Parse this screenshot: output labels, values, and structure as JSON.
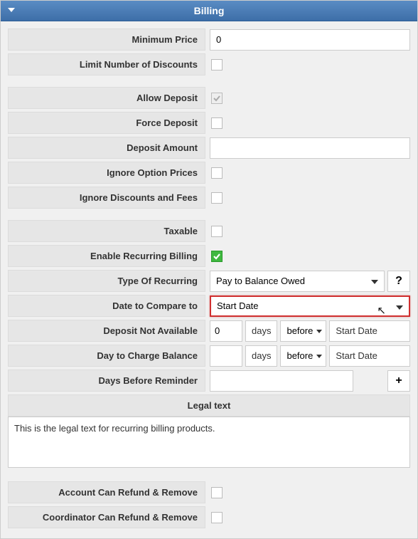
{
  "header": {
    "title": "Billing"
  },
  "fields": {
    "minimum_price": {
      "label": "Minimum Price",
      "value": "0"
    },
    "limit_discounts": {
      "label": "Limit Number of Discounts",
      "checked": false
    },
    "allow_deposit": {
      "label": "Allow Deposit",
      "checked": true,
      "disabled": true
    },
    "force_deposit": {
      "label": "Force Deposit",
      "checked": false
    },
    "deposit_amount": {
      "label": "Deposit Amount",
      "value": ""
    },
    "ignore_option_prices": {
      "label": "Ignore Option Prices",
      "checked": false
    },
    "ignore_discounts_fees": {
      "label": "Ignore Discounts and Fees",
      "checked": false
    },
    "taxable": {
      "label": "Taxable",
      "checked": false
    },
    "enable_recurring": {
      "label": "Enable Recurring Billing",
      "checked": true
    },
    "type_of_recurring": {
      "label": "Type Of Recurring",
      "value": "Pay to Balance Owed"
    },
    "date_compare": {
      "label": "Date to Compare to",
      "value": "Start Date"
    },
    "deposit_not_available": {
      "label": "Deposit Not Available",
      "days": "0",
      "unit": "days",
      "relation": "before",
      "ref": "Start Date"
    },
    "day_charge_balance": {
      "label": "Day to Charge Balance",
      "days": "",
      "unit": "days",
      "relation": "before",
      "ref": "Start Date"
    },
    "days_before_reminder": {
      "label": "Days Before Reminder",
      "value": ""
    },
    "legal_text": {
      "header": "Legal text",
      "value": "This is the legal text for recurring billing products."
    },
    "account_refund": {
      "label": "Account Can Refund & Remove",
      "checked": false
    },
    "coordinator_refund": {
      "label": "Coordinator Can Refund & Remove",
      "checked": false
    }
  },
  "icons": {
    "help": "?",
    "plus": "+"
  }
}
